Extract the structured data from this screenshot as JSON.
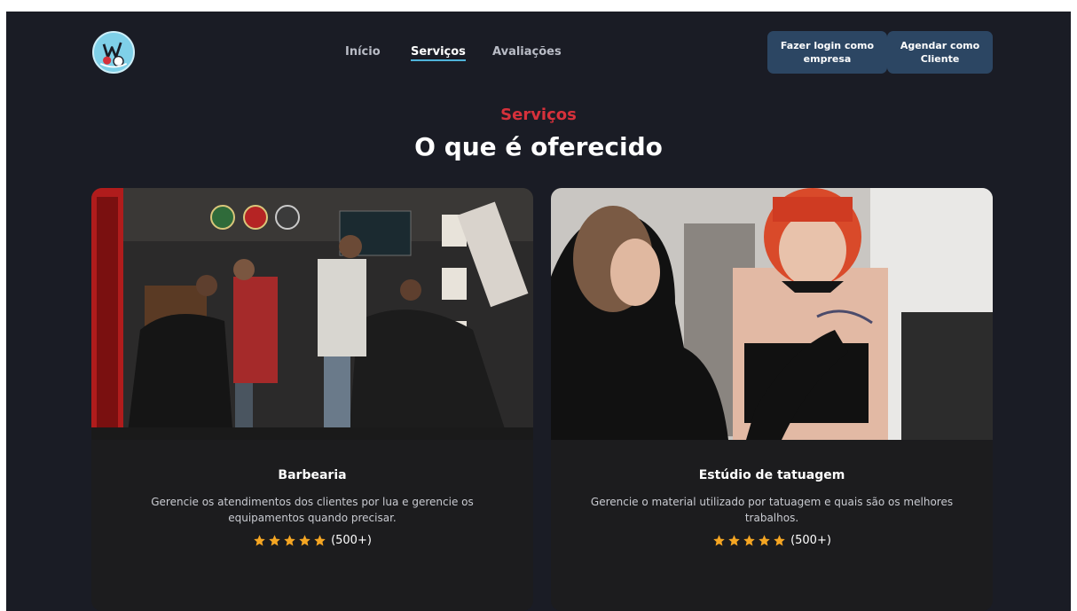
{
  "nav": {
    "links": [
      {
        "label": "Início",
        "active": false
      },
      {
        "label": "Serviços",
        "active": true
      },
      {
        "label": "Avaliações",
        "active": false
      }
    ]
  },
  "header": {
    "login_company_label": "Fazer login como empresa",
    "schedule_client_label": "Agendar como Cliente"
  },
  "section": {
    "eyebrow": "Serviços",
    "title": "O que é oferecido"
  },
  "services": [
    {
      "title": "Barbearia",
      "description": "Gerencie os atendimentos dos clientes por lua e gerencie os equipamentos quando precisar.",
      "rating_stars": 5,
      "rating_count": "(500+)"
    },
    {
      "title": "Estúdio de tatuagem",
      "description": "Gerencie o material utilizado por tatuagem e quais são os melhores trabalhos.",
      "rating_stars": 5,
      "rating_count": "(500+)"
    }
  ],
  "colors": {
    "background": "#1a1c25",
    "card": "#1c1c1e",
    "accent_red": "#d6313b",
    "button": "#2c4663",
    "nav_underline": "#4fb3d9",
    "star": "#f5a623"
  },
  "icons": {
    "logo": "brand-logo-icon",
    "star": "star-icon"
  }
}
